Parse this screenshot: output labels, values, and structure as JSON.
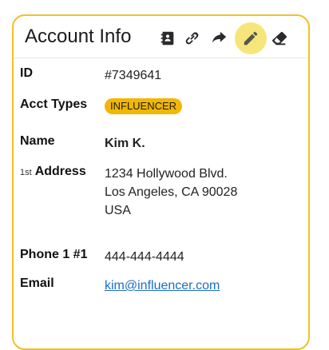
{
  "card": {
    "title": "Account Info",
    "toolbar": [
      {
        "name": "contact-book-icon",
        "active": false
      },
      {
        "name": "link-icon",
        "active": false
      },
      {
        "name": "forward-icon",
        "active": false
      },
      {
        "name": "pencil-icon",
        "active": true
      },
      {
        "name": "eraser-icon",
        "active": false
      }
    ],
    "accent_color": "#f2bf2a"
  },
  "fields": {
    "id": {
      "label": "ID",
      "value": "#7349641"
    },
    "acct_types": {
      "label": "Acct Types",
      "badge": "INFLUENCER"
    },
    "name": {
      "label": "Name",
      "value": "Kim K."
    },
    "address": {
      "prefix": "1st",
      "label": "Address",
      "line1": "1234 Hollywood Blvd.",
      "line2": "Los Angeles, CA 90028",
      "line3": "USA"
    },
    "phone": {
      "label": "Phone 1 #1",
      "value": "444-444-4444"
    },
    "email": {
      "label": "Email",
      "value": "kim@influencer.com"
    }
  }
}
